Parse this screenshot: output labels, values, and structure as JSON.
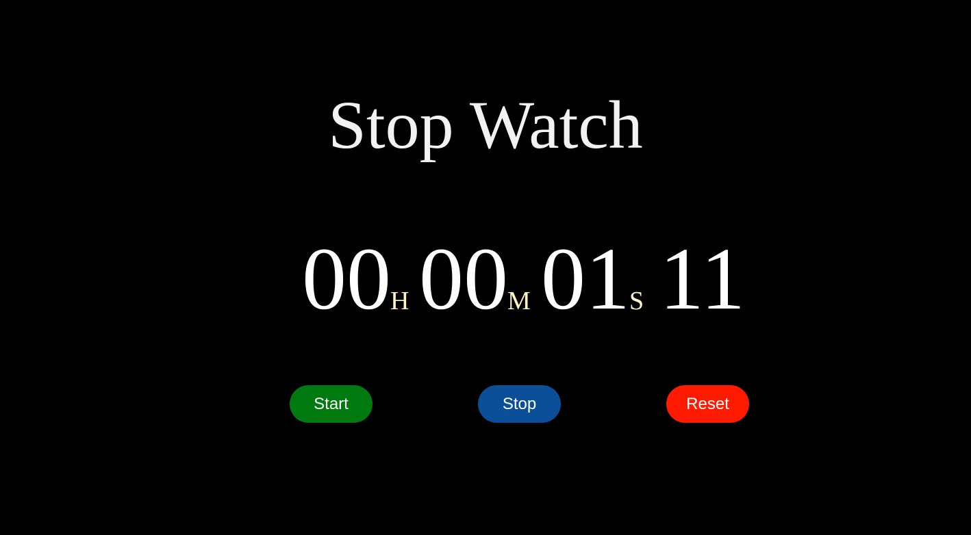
{
  "title": "Stop Watch",
  "timer": {
    "hours": "00",
    "hours_unit": "H",
    "minutes": "00",
    "minutes_unit": "M",
    "seconds": "01",
    "seconds_unit": "S",
    "centiseconds": "11"
  },
  "buttons": {
    "start_label": "Start",
    "stop_label": "Stop",
    "reset_label": "Reset"
  },
  "colors": {
    "background": "#000000",
    "start": "#007a0f",
    "stop": "#0a4f98",
    "reset": "#ff1a00",
    "unit_text": "#fff4c2"
  }
}
